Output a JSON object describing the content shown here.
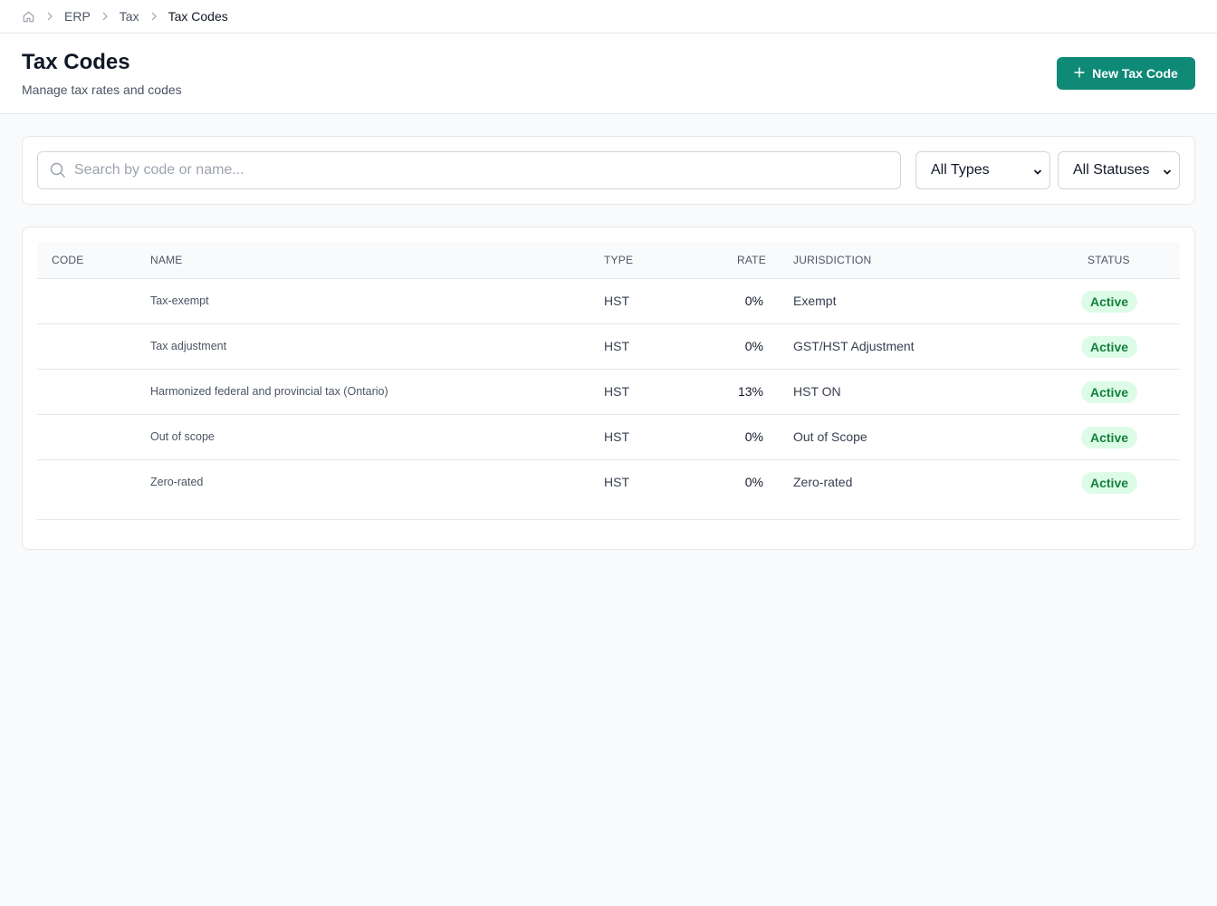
{
  "breadcrumb": {
    "home_icon": "home-icon",
    "items": [
      "ERP",
      "Tax",
      "Tax Codes"
    ]
  },
  "header": {
    "title": "Tax Codes",
    "subtitle": "Manage tax rates and codes",
    "new_button_label": "New Tax Code",
    "new_button_icon": "plus-icon"
  },
  "filters": {
    "search_placeholder": "Search by code or name...",
    "search_value": "",
    "type_select": "All Types",
    "status_select": "All Statuses"
  },
  "table": {
    "columns": [
      "CODE",
      "NAME",
      "TYPE",
      "RATE",
      "JURISDICTION",
      "STATUS"
    ],
    "rows": [
      {
        "code": "",
        "name": "Tax-exempt",
        "type": "HST",
        "rate": "0%",
        "jurisdiction": "Exempt",
        "status": "Active"
      },
      {
        "code": "",
        "name": "Tax adjustment",
        "type": "HST",
        "rate": "0%",
        "jurisdiction": "GST/HST Adjustment",
        "status": "Active"
      },
      {
        "code": "",
        "name": "Harmonized federal and provincial tax (Ontario)",
        "type": "HST",
        "rate": "13%",
        "jurisdiction": "HST ON",
        "status": "Active"
      },
      {
        "code": "",
        "name": "Out of scope",
        "type": "HST",
        "rate": "0%",
        "jurisdiction": "Out of Scope",
        "status": "Active"
      },
      {
        "code": "",
        "name": "Zero-rated",
        "type": "HST",
        "rate": "0%",
        "jurisdiction": "Zero-rated",
        "status": "Active"
      }
    ]
  },
  "colors": {
    "accent": "#0f8a77",
    "status_active_bg": "#dcfce7",
    "status_active_text": "#15803d"
  }
}
